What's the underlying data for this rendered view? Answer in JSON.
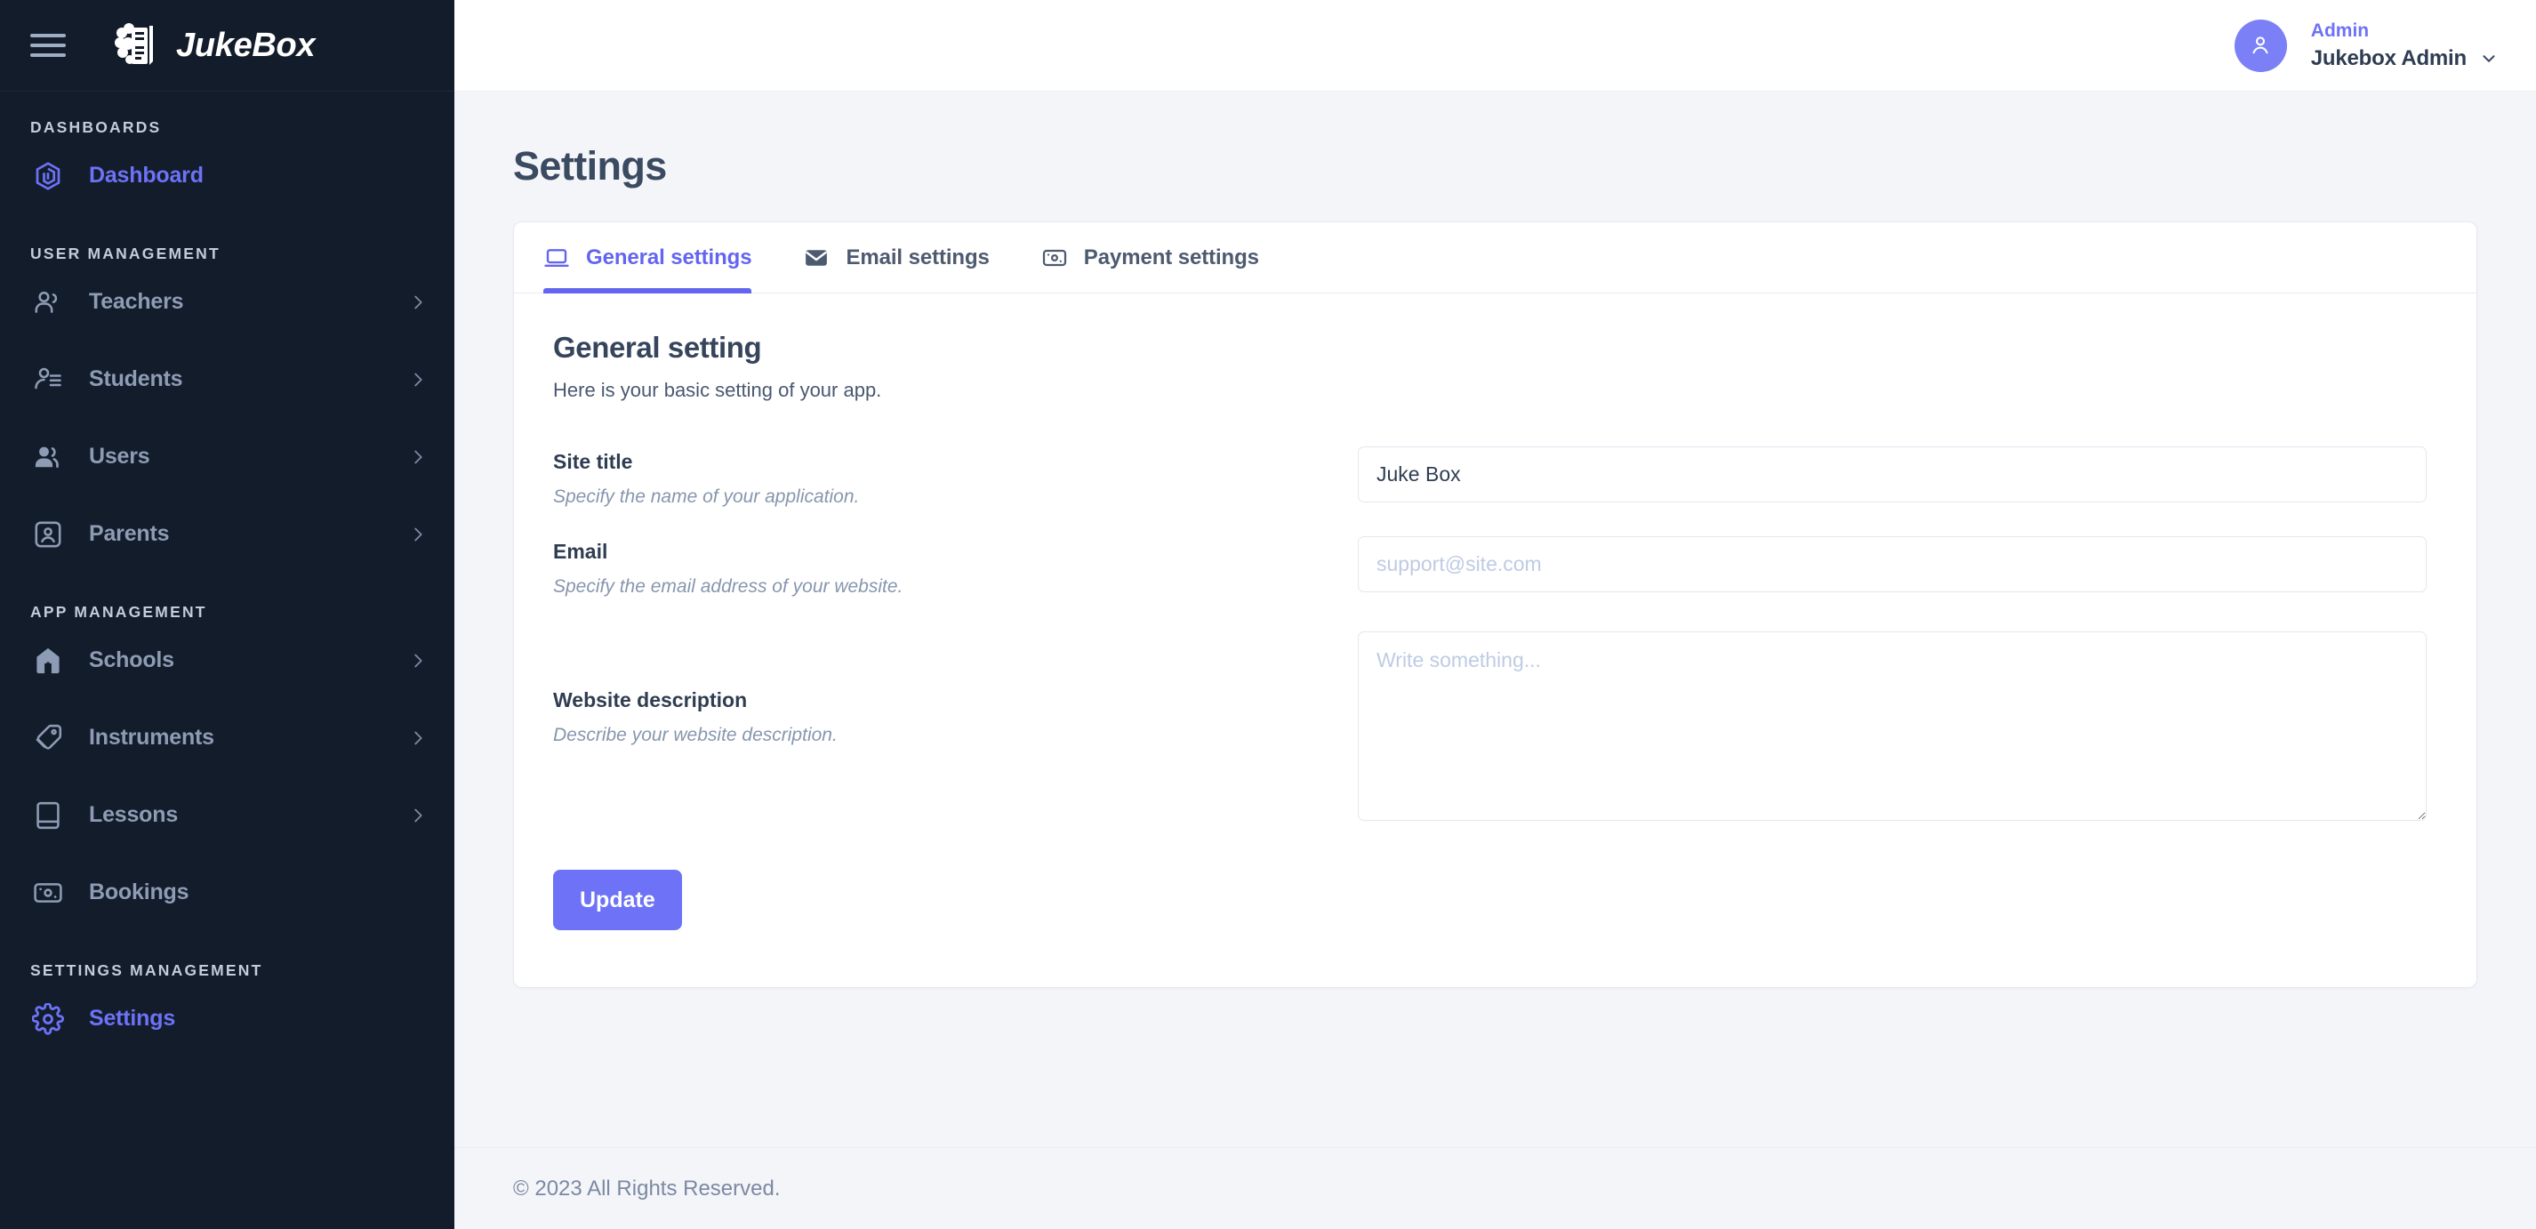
{
  "brand": {
    "title": "JukeBox",
    "logo_icon": "brain-document-icon",
    "menu_icon": "hamburger-menu-icon"
  },
  "sidebar": {
    "groups": [
      {
        "title": "DASHBOARDS",
        "items": [
          {
            "label": "Dashboard",
            "icon": "hexagon-logo-icon",
            "active": true,
            "has_chevron": false
          }
        ]
      },
      {
        "title": "USER MANAGEMENT",
        "items": [
          {
            "label": "Teachers",
            "icon": "users-group-icon",
            "active": false,
            "has_chevron": true
          },
          {
            "label": "Students",
            "icon": "user-list-icon",
            "active": false,
            "has_chevron": true
          },
          {
            "label": "Users",
            "icon": "users-filled-icon",
            "active": false,
            "has_chevron": true
          },
          {
            "label": "Parents",
            "icon": "user-square-icon",
            "active": false,
            "has_chevron": true
          }
        ]
      },
      {
        "title": "APP MANAGEMENT",
        "items": [
          {
            "label": "Schools",
            "icon": "home-icon",
            "active": false,
            "has_chevron": true
          },
          {
            "label": "Instruments",
            "icon": "tag-icon",
            "active": false,
            "has_chevron": true
          },
          {
            "label": "Lessons",
            "icon": "book-icon",
            "active": false,
            "has_chevron": true
          },
          {
            "label": "Bookings",
            "icon": "banknote-icon",
            "active": false,
            "has_chevron": false
          }
        ]
      },
      {
        "title": "SETTINGS MANAGEMENT",
        "items": [
          {
            "label": "Settings",
            "icon": "gear-icon",
            "active": true,
            "has_chevron": false
          }
        ]
      }
    ]
  },
  "topbar": {
    "user_role": "Admin",
    "user_name": "Jukebox Admin",
    "avatar_icon": "user-icon",
    "caret_icon": "chevron-down-icon"
  },
  "page": {
    "title": "Settings"
  },
  "tabs": [
    {
      "label": "General settings",
      "icon": "laptop-icon",
      "active": true
    },
    {
      "label": "Email settings",
      "icon": "envelope-icon",
      "active": false
    },
    {
      "label": "Payment settings",
      "icon": "banknote-icon",
      "active": false
    }
  ],
  "general": {
    "heading": "General setting",
    "subheading": "Here is your basic setting of your app.",
    "fields": [
      {
        "label": "Site title",
        "help": "Specify the name of your application.",
        "value": "Juke Box",
        "placeholder": ""
      },
      {
        "label": "Email",
        "help": "Specify the email address of your website.",
        "value": "",
        "placeholder": "support@site.com"
      },
      {
        "label": "Website description",
        "help": "Describe your website description.",
        "value": "",
        "placeholder": "Write something..."
      }
    ],
    "submit_label": "Update"
  },
  "footer": {
    "copyright": "© 2023 All Rights Reserved."
  },
  "colors": {
    "accent": "#6d72f6",
    "sidebar_bg": "#131c2b",
    "page_bg": "#f4f5f9",
    "heading": "#36455c"
  }
}
